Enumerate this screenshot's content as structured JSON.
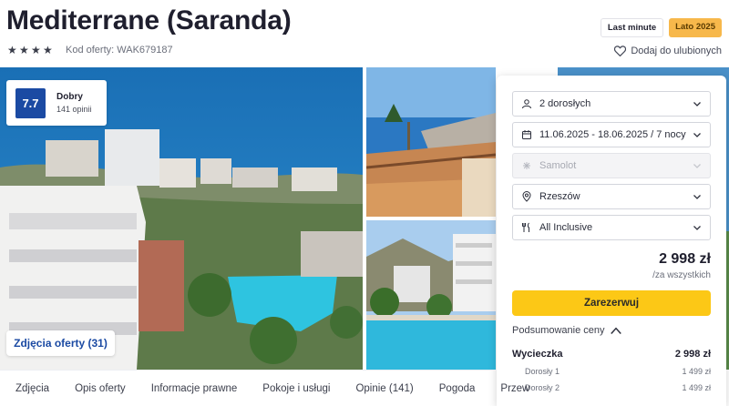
{
  "header": {
    "title": "Mediterrane (Saranda)",
    "stars": 4,
    "offer_code": "Kod oferty: WAK679187",
    "badges": [
      "Last minute",
      "Lato 2025"
    ],
    "favorite_label": "Dodaj do ulubionych"
  },
  "rating": {
    "score": "7.7",
    "label": "Dobry",
    "reviews": "141 opinii"
  },
  "gallery": {
    "photos_button": "Zdjęcia oferty (31)"
  },
  "booking": {
    "travelers": "2 dorosłych",
    "dates": "11.06.2025 - 18.06.2025 / 7 nocy",
    "transport": "Samolot",
    "departure": "Rzeszów",
    "board": "All Inclusive",
    "price": "2 998 zł",
    "price_note": "/za wszystkich",
    "reserve_label": "Zarezerwuj",
    "summary_label": "Podsumowanie ceny",
    "summary": {
      "main_label": "Wycieczka",
      "main_value": "2 998 zł",
      "rows": [
        {
          "label": "Dorosły 1",
          "value": "1 499 zł"
        },
        {
          "label": "Dorosły 2",
          "value": "1 499 zł"
        }
      ]
    }
  },
  "tabs": [
    "Zdjęcia",
    "Opis oferty",
    "Informacje prawne",
    "Pokoje i usługi",
    "Opinie (141)",
    "Pogoda",
    "Przew"
  ],
  "colors": {
    "rating_bg": "#1b4aa3",
    "reserve_bg": "#fcc816",
    "lato_badge": "#f7b84b"
  }
}
